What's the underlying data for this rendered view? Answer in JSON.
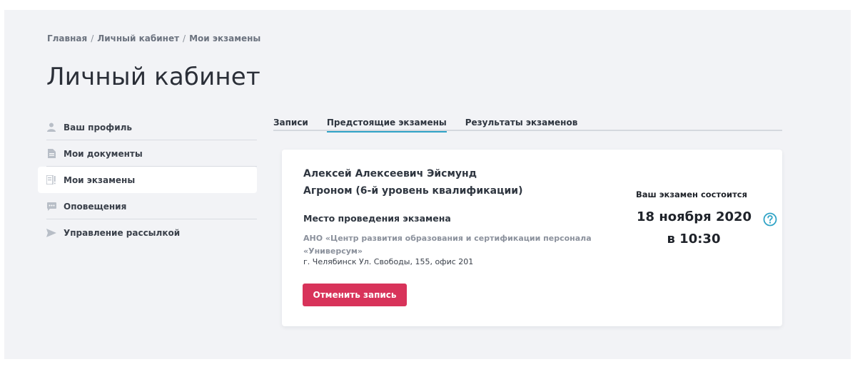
{
  "breadcrumb": {
    "items": [
      "Главная",
      "Личный кабинет",
      "Мои экзамены"
    ],
    "separator": "/"
  },
  "page": {
    "title": "Личный кабинет"
  },
  "sidebar": {
    "items": [
      {
        "label": "Ваш профиль",
        "icon": "user-icon",
        "active": false
      },
      {
        "label": "Мои документы",
        "icon": "document-icon",
        "active": false
      },
      {
        "label": "Мои экзамены",
        "icon": "exam-icon",
        "active": true
      },
      {
        "label": "Оповещения",
        "icon": "chat-icon",
        "active": false
      },
      {
        "label": "Управление рассылкой",
        "icon": "send-icon",
        "active": false
      }
    ]
  },
  "tabs": [
    {
      "label": "Записи",
      "active": false
    },
    {
      "label": "Предстоящие экзамены",
      "active": true
    },
    {
      "label": "Результаты экзаменов",
      "active": false
    }
  ],
  "exam_card": {
    "person_name": "Алексей Алексеевич Эйсмунд",
    "qualification": "Агроном (6-й уровень квалификации)",
    "venue_heading": "Место проведения экзамена",
    "venue_org": "АНО «Центр развития образования и сертификации персонала «Универсум»",
    "venue_address": "г. Челябинск Ул. Свободы, 155, офис 201",
    "cancel_label": "Отменить запись",
    "schedule_caption": "Ваш экзамен состоится",
    "date": "18 ноября 2020",
    "time": "в 10:30",
    "help_icon": "question-circle-icon"
  },
  "colors": {
    "background": "#f2f3f6",
    "accent": "#2fa3c6",
    "danger_button": "#d8335a",
    "icon_gray": "#b8bec7"
  }
}
